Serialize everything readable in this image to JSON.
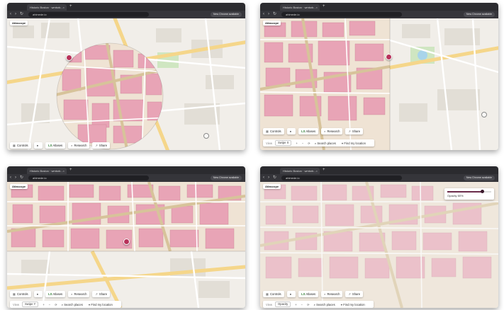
{
  "colors": {
    "chrome_bg": "#2b2b2f",
    "map_bg": "#f1eee9",
    "historic_overlay": "#e8a4b6",
    "road": "#f5d68a",
    "marker": "#b8325a",
    "park": "#cfe6c1",
    "water": "#a8d4ea"
  },
  "panels": [
    {
      "tab": {
        "title": "Historic Boston · wmtsrb..."
      },
      "toolbar": {
        "url": "ahlmede.io",
        "update_label": "New Chrome available"
      },
      "brand": "Atlascope",
      "buttons": [
        {
          "icon": "grid-icon",
          "label": "Controls"
        },
        {
          "icon": "dot-icon",
          "label": ""
        },
        {
          "icon": "",
          "label": "Atlases",
          "accent": "LS"
        },
        {
          "icon": "search-icon",
          "label": "Research"
        },
        {
          "icon": "share-icon",
          "label": "Share"
        }
      ],
      "overlay_mode": "circle"
    },
    {
      "tab": {
        "title": "Historic Boston · wmtsrb..."
      },
      "toolbar": {
        "url": "ahlmede.io",
        "update_label": "New Chrome available"
      },
      "brand": "Atlascope",
      "buttons": [
        {
          "icon": "grid-icon",
          "label": "Controls"
        },
        {
          "icon": "dot-icon",
          "label": ""
        },
        {
          "icon": "",
          "label": "Atlases",
          "accent": "LS"
        },
        {
          "icon": "search-icon",
          "label": "Research"
        },
        {
          "icon": "share-icon",
          "label": "Share"
        }
      ],
      "controls": {
        "view_label": "View",
        "mode": "Swipe X",
        "items": [
          "Search places",
          "Find my location"
        ]
      },
      "overlay_mode": "swipe-x"
    },
    {
      "tab": {
        "title": "Historic Boston · wmtsrb..."
      },
      "toolbar": {
        "url": "ahlmede.io",
        "update_label": "New Chrome available"
      },
      "brand": "Atlascope",
      "buttons": [
        {
          "icon": "grid-icon",
          "label": "Controls"
        },
        {
          "icon": "dot-icon",
          "label": ""
        },
        {
          "icon": "",
          "label": "Atlases",
          "accent": "LS"
        },
        {
          "icon": "search-icon",
          "label": "Research"
        },
        {
          "icon": "share-icon",
          "label": "Share"
        }
      ],
      "controls": {
        "view_label": "View",
        "mode": "Swipe Y",
        "items": [
          "Search places",
          "Find my location"
        ]
      },
      "overlay_mode": "swipe-y"
    },
    {
      "tab": {
        "title": "Historic Boston · wmtsrb..."
      },
      "toolbar": {
        "url": "ahlmede.io",
        "update_label": "New Chrome available"
      },
      "brand": "Atlascope",
      "buttons": [
        {
          "icon": "grid-icon",
          "label": "Controls"
        },
        {
          "icon": "dot-icon",
          "label": ""
        },
        {
          "icon": "",
          "label": "Atlases",
          "accent": "LS"
        },
        {
          "icon": "search-icon",
          "label": "Research"
        },
        {
          "icon": "share-icon",
          "label": "Share"
        }
      ],
      "controls": {
        "view_label": "View",
        "mode": "Opacity",
        "items": [
          "Search places",
          "Find my location"
        ]
      },
      "opacity_popup": {
        "label": "Opacity 80%",
        "value": 0.8
      },
      "overlay_mode": "opacity"
    }
  ]
}
